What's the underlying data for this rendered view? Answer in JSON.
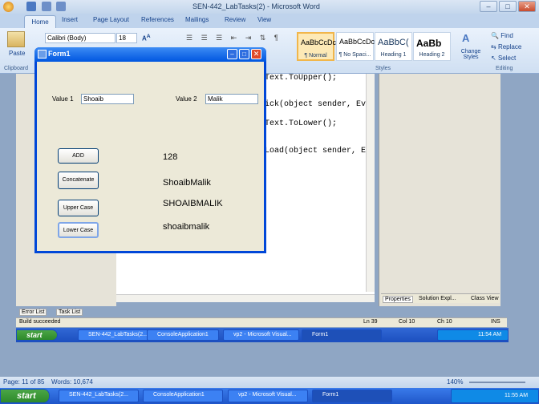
{
  "word": {
    "title": "SEN-442_LabTasks(2) - Microsoft Word",
    "tabs": [
      "Home",
      "Insert",
      "Page Layout",
      "References",
      "Mailings",
      "Review",
      "View"
    ],
    "clipboard": {
      "paste_label": "Paste",
      "group_label": "Clipboard"
    },
    "font": {
      "name": "Calibri (Body)",
      "size": "18"
    },
    "styles": [
      {
        "preview": "AaBbCcDc",
        "name": "¶ Normal"
      },
      {
        "preview": "AaBbCcDc",
        "name": "¶ No Spaci..."
      },
      {
        "preview": "AaBbC(",
        "name": "Heading 1"
      },
      {
        "preview": "AaBb",
        "name": "Heading 2"
      }
    ],
    "styles_group_label": "Styles",
    "change_styles_label": "Change Styles",
    "editing": {
      "find": "Find",
      "replace": "Replace",
      "select": "Select",
      "group_label": "Editing"
    },
    "status": {
      "page": "Page: 11 of 85",
      "words": "Words: 10,674",
      "zoom": "140%"
    }
  },
  "vs": {
    "code_lines": [
      "Text.ToUpper();",
      "ick(object sender, Eve",
      "Text.ToLower();",
      "Load(object sender, Ev"
    ],
    "right_tabs": [
      "Properties",
      "Solution Expl...",
      "Class View"
    ],
    "bottom_tabs": [
      "Error List",
      "Task List"
    ],
    "status": {
      "message": "Build succeeded",
      "ln": "Ln 39",
      "col": "Col 10",
      "ch": "Ch 10",
      "mode": "INS"
    }
  },
  "inner_taskbar": {
    "start": "start",
    "items": [
      "SEN-442_LabTasks(2...",
      "ConsoleApplication1",
      "vp2 - Microsoft Visual...",
      "Form1"
    ],
    "clock": "11:54 AM"
  },
  "main_taskbar": {
    "start": "start",
    "items": [
      "SEN-442_LabTasks(2...",
      "ConsoleApplication1",
      "vp2 - Microsoft Visual...",
      "Form1"
    ],
    "clock": "11:55 AM"
  },
  "form1": {
    "title": "Form1",
    "value1_label": "Value 1",
    "value1": "Shoaib",
    "value2_label": "Value 2",
    "value2": "Malik",
    "buttons": {
      "add": "ADD",
      "concat": "Concatenate",
      "upper": "Upper Case",
      "lower": "Lower Case"
    },
    "outputs": {
      "sum": "128",
      "concat": "ShoaibMalik",
      "upper": "SHOAIBMALIK",
      "lower": "shoaibmalik"
    }
  },
  "colors": {
    "xp_blue": "#0047d8",
    "start_green": "#2d8a2a",
    "ribbon": "#cfdff2"
  }
}
